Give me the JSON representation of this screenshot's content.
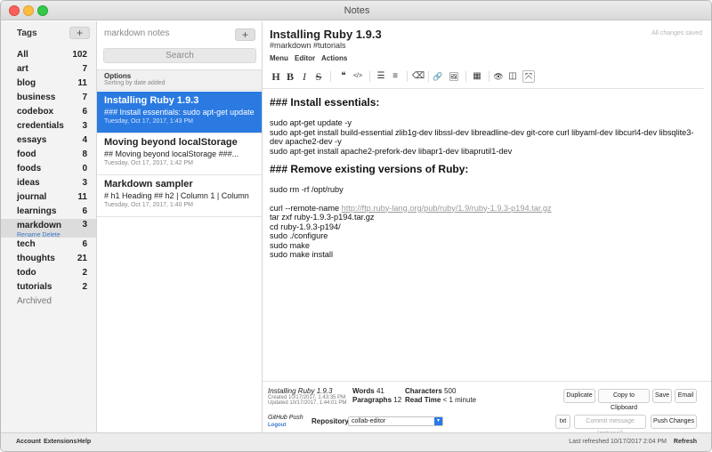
{
  "window": {
    "title": "Notes"
  },
  "tags": {
    "heading": "Tags",
    "add_label": "+",
    "items": [
      {
        "name": "All",
        "count": "102"
      },
      {
        "name": "art",
        "count": "7"
      },
      {
        "name": "blog",
        "count": "11"
      },
      {
        "name": "business",
        "count": "7"
      },
      {
        "name": "codebox",
        "count": "6"
      },
      {
        "name": "credentials",
        "count": "3"
      },
      {
        "name": "essays",
        "count": "4"
      },
      {
        "name": "food",
        "count": "8"
      },
      {
        "name": "foods",
        "count": "0"
      },
      {
        "name": "ideas",
        "count": "3"
      },
      {
        "name": "journal",
        "count": "11"
      },
      {
        "name": "learnings",
        "count": "6"
      },
      {
        "name": "markdown",
        "count": "3",
        "actions": "Rename Delete"
      },
      {
        "name": "tech",
        "count": "6"
      },
      {
        "name": "thoughts",
        "count": "21"
      },
      {
        "name": "todo",
        "count": "2"
      },
      {
        "name": "tutorials",
        "count": "2"
      }
    ],
    "archived": "Archived"
  },
  "notes": {
    "title": "markdown notes",
    "add_label": "+",
    "search_placeholder": "Search",
    "options_label": "Options",
    "sorting_label": "Sorting by date added",
    "items": [
      {
        "title": "Installing Ruby 1.9.3",
        "preview": "### Install essentials: sudo apt-get update -y",
        "date": "Tuesday, Oct 17, 2017, 1:43 PM"
      },
      {
        "title": "Moving beyond localStorage",
        "preview": "## Moving beyond localStorage ###...",
        "date": "Tuesday, Oct 17, 2017, 1:42 PM"
      },
      {
        "title": "Markdown sampler",
        "preview": "# h1 Heading ## h2 | Column 1 | Column",
        "date": "Tuesday, Oct 17, 2017, 1:40 PM"
      }
    ]
  },
  "editor": {
    "title": "Installing Ruby 1.9.3",
    "tags": "#markdown #tutorials",
    "status": "All changes saved",
    "menus": [
      "Menu",
      "Editor",
      "Actions"
    ],
    "toolbar": [
      "H",
      "B",
      "I",
      "S",
      "❝",
      "</>",
      "☰",
      "≡",
      "⌫",
      "🔗",
      "🖼",
      "▦",
      "👁",
      "◫",
      "⤧"
    ],
    "content": {
      "h1": "### Install essentials:",
      "l1": "sudo apt-get update -y",
      "l2": "sudo apt-get install build-essential zlib1g-dev libssl-dev libreadline-dev  git-core curl libyaml-dev libcurl4-dev libsqlite3-dev apache2-dev -y",
      "l3": "sudo apt-get install apache2-prefork-dev libapr1-dev libaprutil1-dev",
      "h2": "### Remove existing versions of Ruby:",
      "l4": "sudo rm -rf /opt/ruby",
      "l5": "curl --remote-name ",
      "link": "http://ftp.ruby-lang.org/pub/ruby/1.9/ruby-1.9.3-p194.tar.gz",
      "l6": "tar zxf ruby-1.9.3-p194.tar.gz",
      "l7": "cd ruby-1.9.3-p194/",
      "l8": "sudo ./configure",
      "l9": "sudo make",
      "l10": "sudo make install"
    }
  },
  "info": {
    "title": "Installing Ruby 1.9.3",
    "created": "Created 10/17/2017, 1:43:35 PM",
    "updated": "Updated 10/17/2017, 1:44:01 PM",
    "words_label": "Words",
    "words": "41",
    "paragraphs_label": "Paragraphs",
    "paragraphs": "12",
    "characters_label": "Characters",
    "characters": "500",
    "readtime_label": "Read Time",
    "readtime": "< 1 minute",
    "buttons": {
      "duplicate": "Duplicate",
      "clipboard": "Copy to Clipboard",
      "save": "Save",
      "email": "Email"
    },
    "github_push": "GitHub Push",
    "logout": "Logout",
    "repository_label": "Repository",
    "repository": "collab-editor",
    "txt": "txt",
    "commit_placeholder": "Commit message (optional)",
    "push": "Push Changes"
  },
  "footer": {
    "account": "Account",
    "extensions": "Extensions",
    "help": "Help",
    "last_refreshed": "Last refreshed 10/17/2017 2:04 PM",
    "refresh": "Refresh"
  }
}
